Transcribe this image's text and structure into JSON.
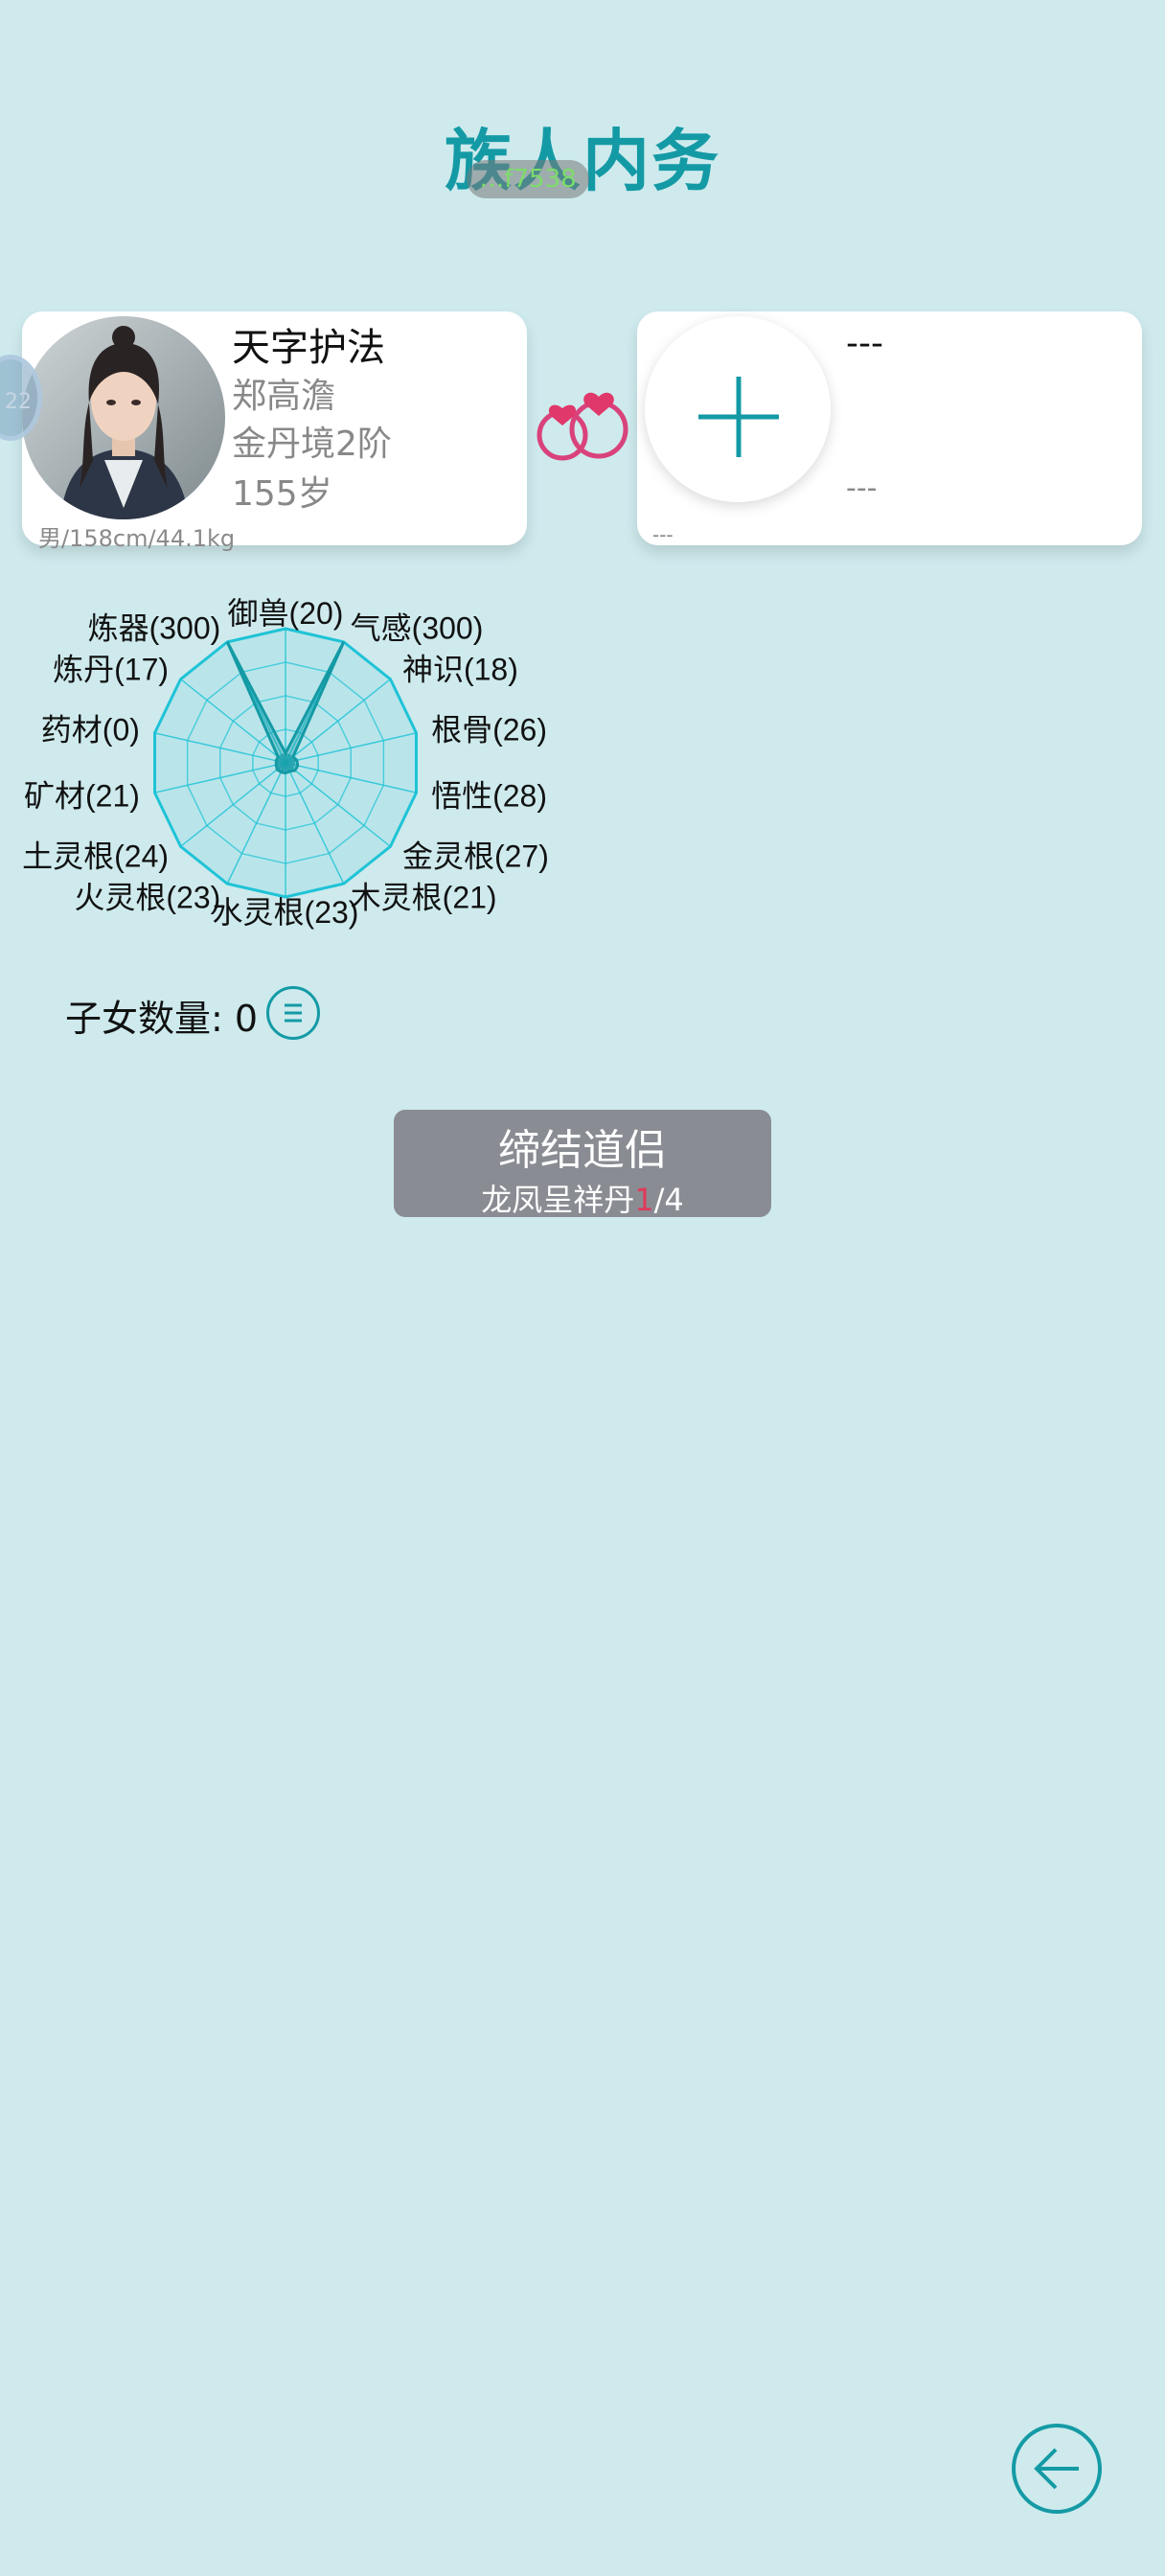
{
  "header": {
    "title": "族人内务",
    "pill_text": "…f7538"
  },
  "member": {
    "side_badge": "22",
    "rank": "天字护法",
    "name": "郑高澹",
    "realm": "金丹境2阶",
    "age": "155岁",
    "body": "男/158cm/44.1kg"
  },
  "partner": {
    "name": "---",
    "info": "---",
    "body": "---"
  },
  "radar": {
    "type": "radar",
    "max": 300,
    "stats": [
      {
        "label": "御兽(20)",
        "value": 20
      },
      {
        "label": "气感(300)",
        "value": 300
      },
      {
        "label": "神识(18)",
        "value": 18
      },
      {
        "label": "根骨(26)",
        "value": 26
      },
      {
        "label": "悟性(28)",
        "value": 28
      },
      {
        "label": "金灵根(27)",
        "value": 27
      },
      {
        "label": "木灵根(21)",
        "value": 21
      },
      {
        "label": "水灵根(23)",
        "value": 23
      },
      {
        "label": "火灵根(23)",
        "value": 23
      },
      {
        "label": "土灵根(24)",
        "value": 24
      },
      {
        "label": "矿材(21)",
        "value": 21
      },
      {
        "label": "药材(0)",
        "value": 0
      },
      {
        "label": "炼丹(17)",
        "value": 17
      },
      {
        "label": "炼器(300)",
        "value": 300
      }
    ]
  },
  "children": {
    "label": "子女数量: 0"
  },
  "bond_button": {
    "title": "缔结道侣",
    "item": "龙凤呈祥丹",
    "current": "1",
    "total": "/4"
  },
  "colors": {
    "accent": "#149aa5",
    "background": "#ceeaed",
    "radar_line": "#1fc3d6",
    "heart": "#e0386a"
  },
  "icons": {
    "add": "plus-icon",
    "rings": "rings-icon",
    "list": "list-icon",
    "back": "back-arrow-icon"
  }
}
